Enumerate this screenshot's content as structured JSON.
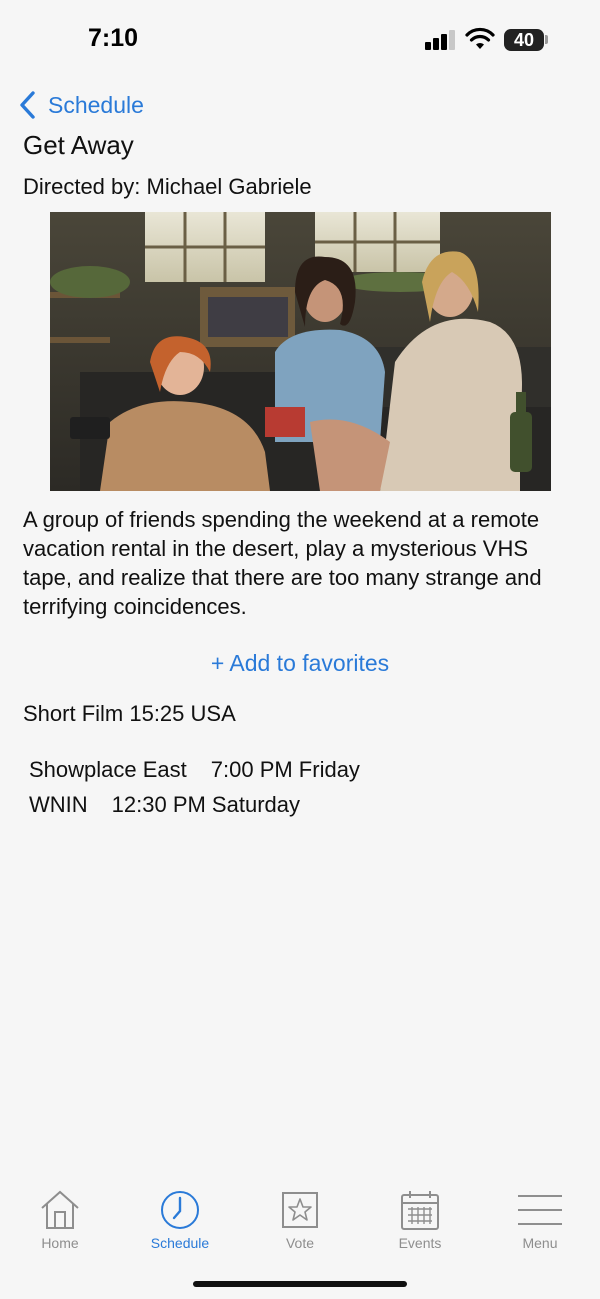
{
  "status_bar": {
    "time": "7:10",
    "battery": "40"
  },
  "nav": {
    "back_label": "Schedule"
  },
  "film": {
    "title": "Get Away",
    "director_line": "Directed by: Michael Gabriele",
    "synopsis": "A group of friends spending the weekend at a remote vacation rental in the desert, play a mysterious VHS tape, and realize that there are too many strange and terrifying coincidences.",
    "meta": "Short Film 15:25 USA"
  },
  "actions": {
    "favorite_label": "+ Add to favorites"
  },
  "screenings": [
    {
      "venue": "Showplace East",
      "time": "7:00 PM Friday"
    },
    {
      "venue": "WNIN",
      "time": "12:30 PM Saturday"
    }
  ],
  "tabs": [
    {
      "label": "Home",
      "icon": "home-icon",
      "active": false
    },
    {
      "label": "Schedule",
      "icon": "clock-icon",
      "active": true
    },
    {
      "label": "Vote",
      "icon": "star-icon",
      "active": false
    },
    {
      "label": "Events",
      "icon": "calendar-icon",
      "active": false
    },
    {
      "label": "Menu",
      "icon": "menu-icon",
      "active": false
    }
  ],
  "colors": {
    "accent": "#2a7ad8",
    "inactive_tab": "#8e8e8e",
    "background": "#f6f6f6"
  }
}
